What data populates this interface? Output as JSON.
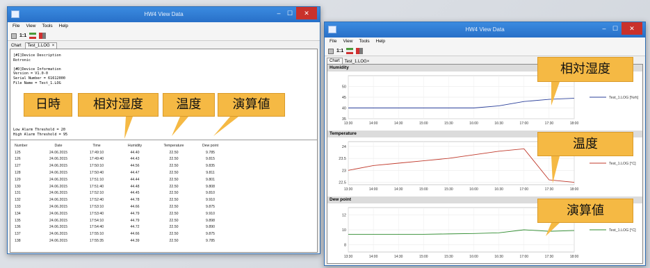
{
  "left_window": {
    "title": "HW4 View Data",
    "menu": [
      "File",
      "View",
      "Tools",
      "Help"
    ],
    "toolbar": {
      "zoom_label": "1:1"
    },
    "tab": {
      "label": "Chart",
      "file_tab": "Test_1.LOG",
      "close": "×"
    },
    "log_lines": [
      "[#I]Device Description",
      "Rotronic",
      "",
      "[#D]Device Information",
      "Version = V1.0-0",
      "Serial Number = 61612000",
      "File Name = Test_1.LOG"
    ],
    "log_tail": [
      "Low Alarm Threshold = 20",
      "High Alarm Threshold = 95"
    ],
    "table": {
      "headers": [
        "Number",
        "Date",
        "Time",
        "Humidity",
        "Temperature",
        "Dew point"
      ],
      "rows": [
        [
          "125",
          "24.06.2015",
          "17:49:10",
          "44.40",
          "22.50",
          "9.785"
        ],
        [
          "126",
          "24.06.2015",
          "17:49:40",
          "44.43",
          "22.50",
          "9.815"
        ],
        [
          "127",
          "24.06.2015",
          "17:50:10",
          "44.56",
          "22.50",
          "9.835"
        ],
        [
          "128",
          "24.06.2015",
          "17:50:40",
          "44.47",
          "22.50",
          "9.811"
        ],
        [
          "129",
          "24.06.2015",
          "17:51:10",
          "44.44",
          "22.50",
          "9.801"
        ],
        [
          "130",
          "24.06.2015",
          "17:51:40",
          "44.48",
          "22.50",
          "9.808"
        ],
        [
          "131",
          "24.06.2015",
          "17:52:10",
          "44.45",
          "22.50",
          "9.810"
        ],
        [
          "132",
          "24.06.2015",
          "17:52:40",
          "44.78",
          "22.50",
          "9.910"
        ],
        [
          "133",
          "24.06.2015",
          "17:53:10",
          "44.66",
          "22.50",
          "9.875"
        ],
        [
          "134",
          "24.06.2015",
          "17:53:40",
          "44.79",
          "22.50",
          "9.910"
        ],
        [
          "135",
          "24.06.2015",
          "17:54:10",
          "44.79",
          "22.50",
          "9.898"
        ],
        [
          "136",
          "24.06.2015",
          "17:54:40",
          "44.72",
          "22.50",
          "9.890"
        ],
        [
          "137",
          "24.06.2015",
          "17:55:10",
          "44.66",
          "22.50",
          "9.875"
        ],
        [
          "138",
          "24.06.2015",
          "17:55:35",
          "44.39",
          "22.50",
          "9.785"
        ]
      ]
    },
    "callouts": {
      "date_time": "日時",
      "humidity": "相対湿度",
      "temperature": "温度",
      "dew_point": "演算値"
    }
  },
  "right_window": {
    "title": "HW4 View Data",
    "menu": [
      "File",
      "View",
      "Tools",
      "Help"
    ],
    "toolbar": {
      "zoom_label": "1:1"
    },
    "tab": {
      "label": "Chart",
      "file_tab": "Test_1.LOG",
      "close": "×"
    },
    "callouts": {
      "humidity": "相対湿度",
      "temperature": "温度",
      "dew_point": "演算値"
    }
  },
  "colors": {
    "titlebar": "#2f7bd8",
    "callout": "#f5b944",
    "humidity_line": "#2a3f9a",
    "temperature_line": "#c0392b",
    "dewpoint_line": "#2e8b2e"
  },
  "chart_data": [
    {
      "type": "line",
      "title": "Humidity",
      "x": [
        "13:30",
        "14:00",
        "14:30",
        "15:00",
        "15:30",
        "16:00",
        "16:30",
        "17:00",
        "17:30",
        "18:00"
      ],
      "ylim": [
        35,
        55
      ],
      "yticks": [
        35,
        40,
        45,
        50
      ],
      "series": [
        {
          "name": "Test_1.LOG [%rh]",
          "values": [
            40,
            40,
            40,
            40,
            40,
            40,
            41,
            43,
            44,
            44.5
          ]
        }
      ]
    },
    {
      "type": "line",
      "title": "Temperature",
      "x": [
        "13:30",
        "14:00",
        "14:30",
        "15:00",
        "15:30",
        "16:00",
        "16:30",
        "17:00",
        "17:30",
        "18:00"
      ],
      "ylim": [
        22.4,
        24.2
      ],
      "yticks": [
        22.5,
        23,
        23.5,
        24
      ],
      "series": [
        {
          "name": "Test_1.LOG [°C]",
          "values": [
            23.0,
            23.2,
            23.3,
            23.4,
            23.5,
            23.65,
            23.8,
            23.9,
            22.6,
            22.5
          ]
        }
      ]
    },
    {
      "type": "line",
      "title": "Dew point",
      "x": [
        "13:30",
        "14:00",
        "14:30",
        "15:00",
        "15:30",
        "16:00",
        "16:30",
        "17:00",
        "17:30",
        "18:00"
      ],
      "ylim": [
        7,
        13
      ],
      "yticks": [
        8,
        10,
        12
      ],
      "series": [
        {
          "name": "Test_1.LOG [°C]",
          "values": [
            9.4,
            9.4,
            9.4,
            9.4,
            9.45,
            9.5,
            9.6,
            10.0,
            9.8,
            9.9
          ]
        }
      ]
    }
  ]
}
